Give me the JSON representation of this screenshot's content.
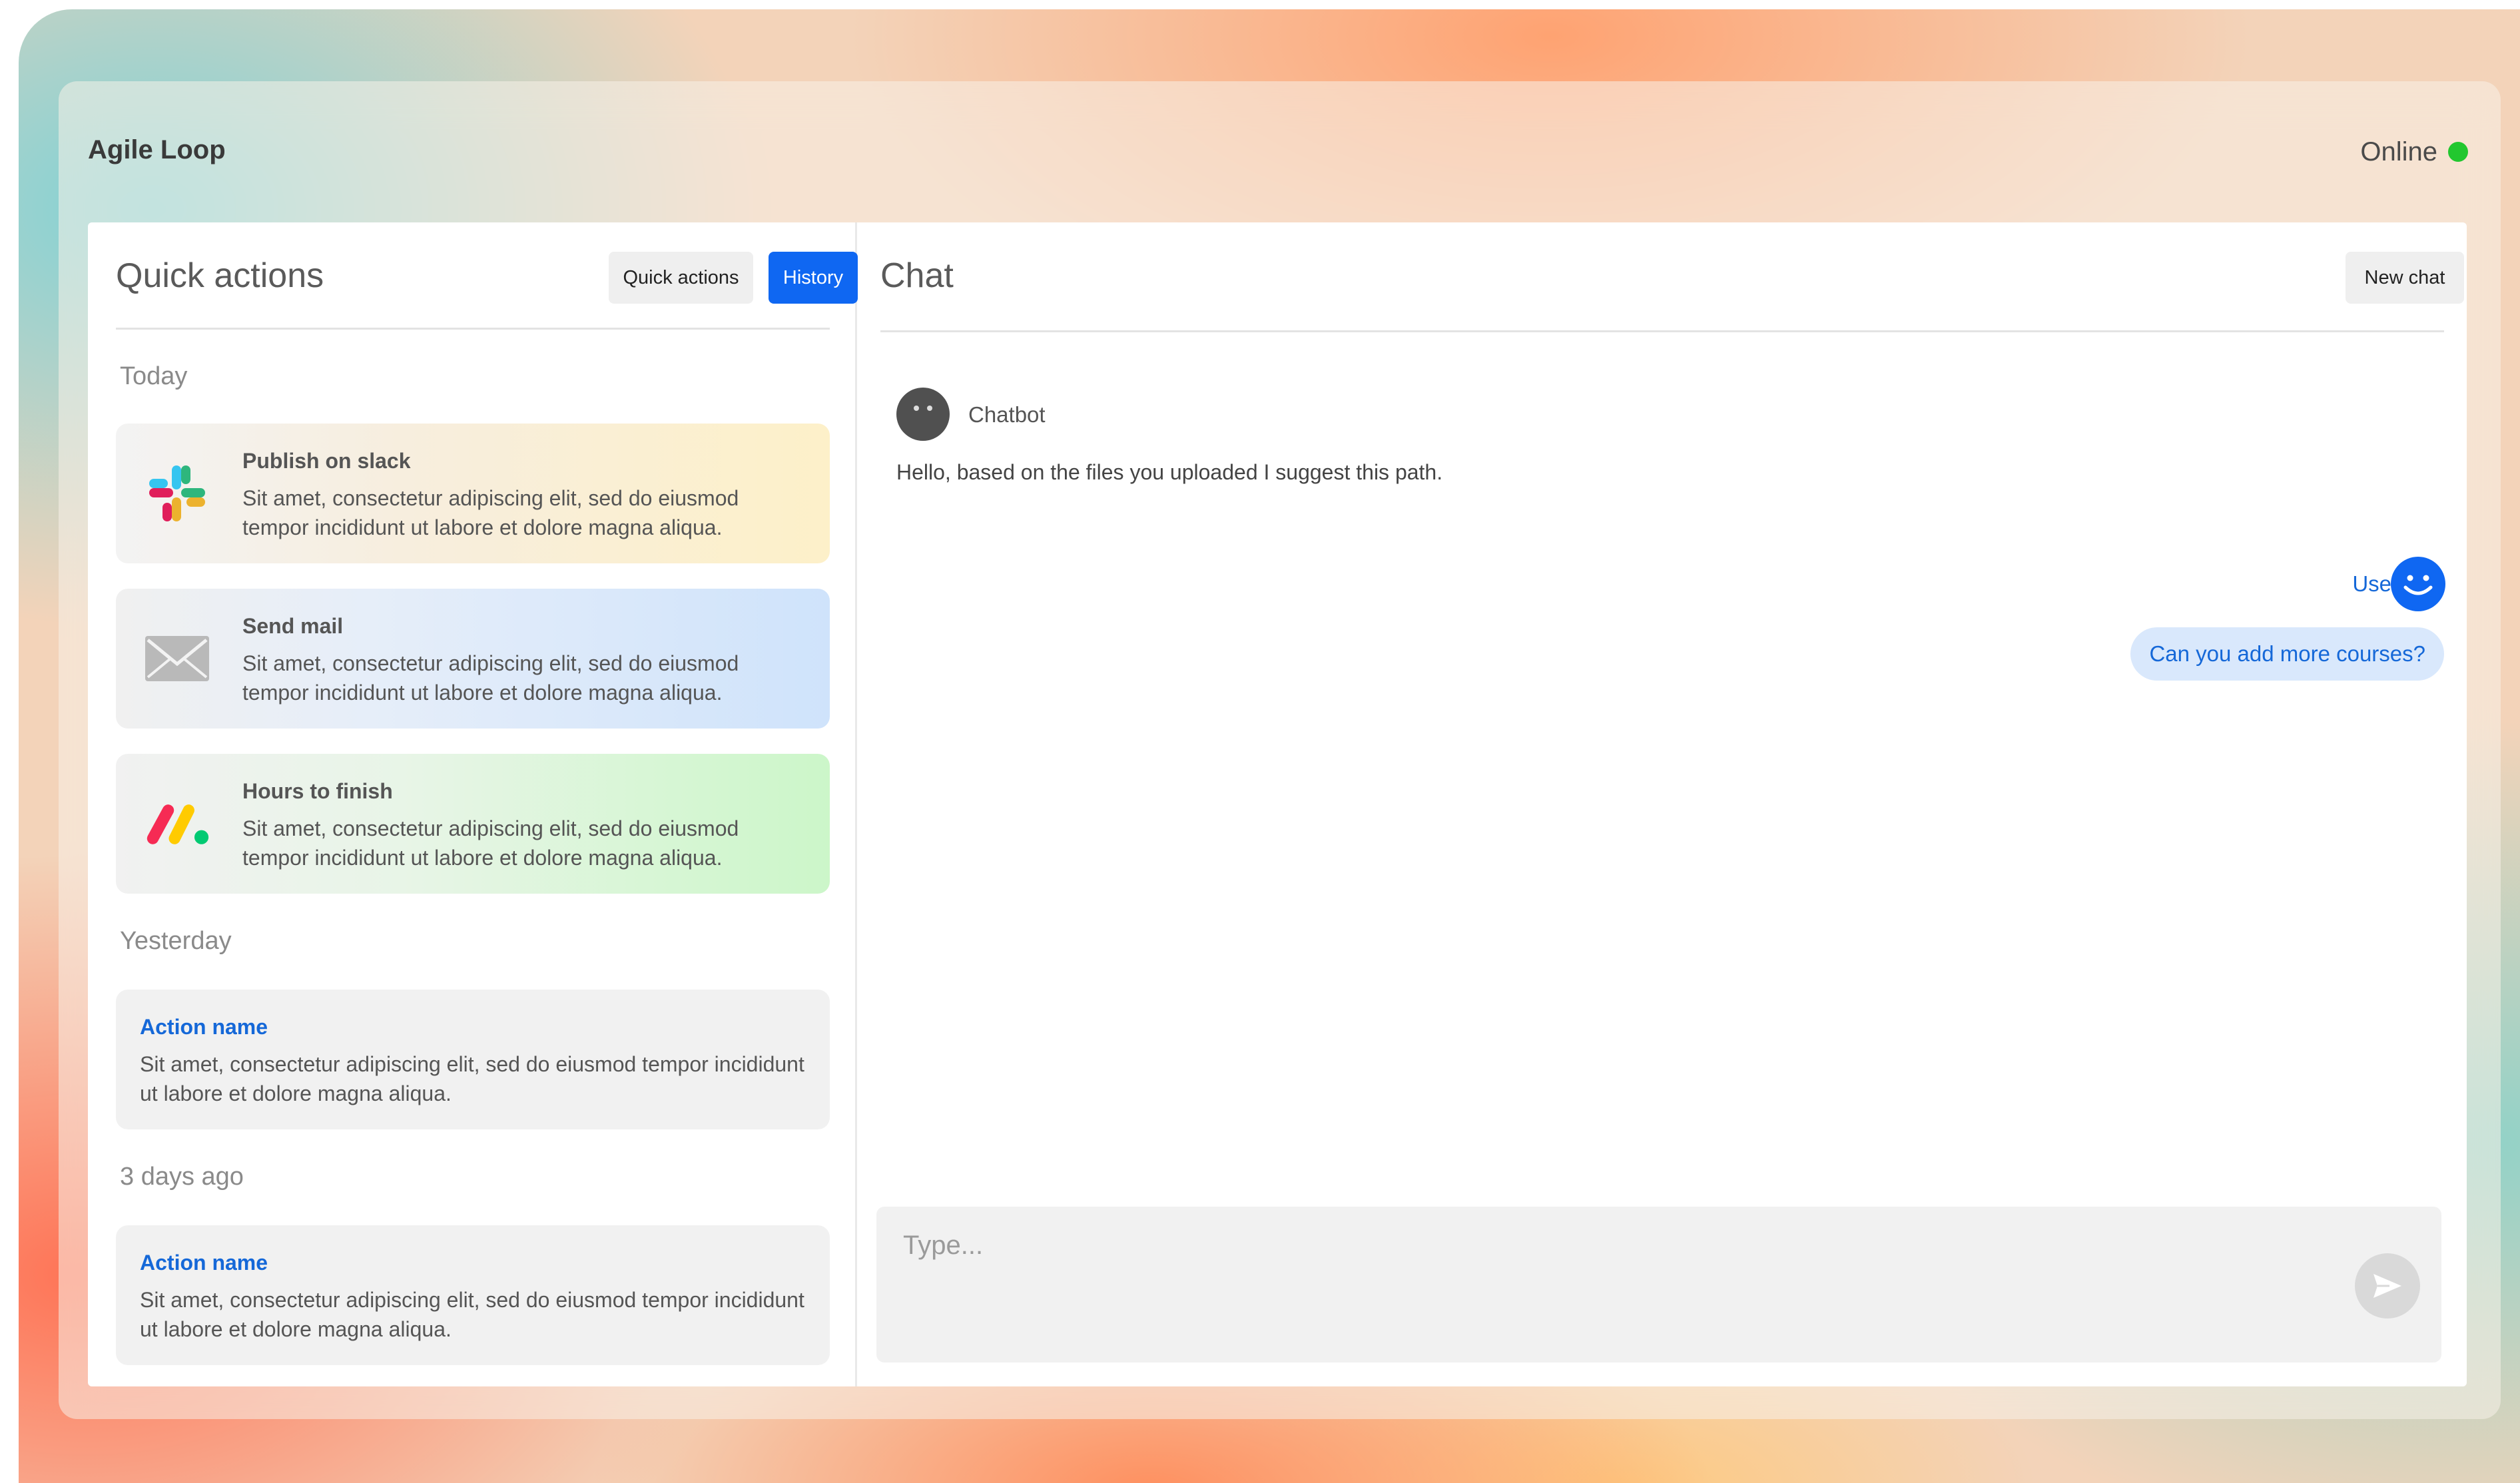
{
  "app": {
    "title": "Agile Loop",
    "status_label": "Online",
    "status_color": "#22c72f",
    "accent_color": "#0f67f2"
  },
  "left_panel": {
    "title": "Quick actions",
    "tabs": [
      {
        "label": "Quick actions",
        "active": false
      },
      {
        "label": "History",
        "active": true
      }
    ],
    "sections": [
      {
        "label": "Today",
        "items": [
          {
            "icon": "slack-icon",
            "title": "Publish on slack",
            "description": "Sit amet, consectetur adipiscing elit, sed do eiusmod tempor incididunt ut labore et dolore magna aliqua."
          },
          {
            "icon": "mail-icon",
            "title": "Send mail",
            "description": "Sit amet, consectetur adipiscing elit, sed do eiusmod tempor incididunt ut labore et dolore magna aliqua."
          },
          {
            "icon": "monday-icon",
            "title": "Hours to finish",
            "description": "Sit amet, consectetur adipiscing elit, sed do eiusmod tempor incididunt ut labore et dolore magna aliqua."
          }
        ]
      },
      {
        "label": "Yesterday",
        "items": [
          {
            "title": "Action name",
            "description": "Sit amet, consectetur adipiscing elit, sed do eiusmod tempor incididunt ut labore et dolore magna aliqua."
          }
        ]
      },
      {
        "label": "3 days ago",
        "items": [
          {
            "title": "Action name",
            "description": "Sit amet, consectetur adipiscing elit, sed do eiusmod tempor incididunt ut labore et dolore magna aliqua."
          }
        ]
      }
    ]
  },
  "chat": {
    "title": "Chat",
    "new_chat_label": "New chat",
    "messages": [
      {
        "sender": "Chatbot",
        "text": "Hello, based on the files you uploaded I suggest this path."
      },
      {
        "sender": "User",
        "text": "Can you add more courses?"
      }
    ],
    "composer": {
      "placeholder": "Type...",
      "value": "",
      "send_icon": "send-icon"
    }
  }
}
